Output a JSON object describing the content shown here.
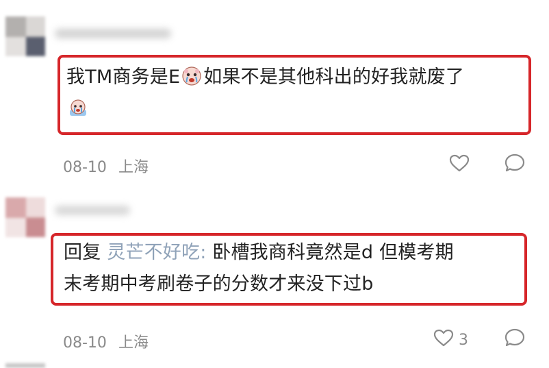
{
  "comments": [
    {
      "text_before_emoji": "我TM商务是E",
      "emoji_1": "crying-face-emoji",
      "text_after_emoji": "如果不是其他科出的好我就废了",
      "emoji_2": "crying-face-emoji",
      "date": "08-10",
      "location": "上海",
      "like_icon": "heart-outline-icon",
      "reply_icon": "speech-bubble-icon",
      "highlight_color": "#d6262a"
    },
    {
      "reply_prefix": "回复",
      "reply_target": "灵芒不好吃:",
      "line_1": " 卧槽我商科竟然是d 但模考期",
      "line_2": "末考期中考刷卷子的分数才来没下过b",
      "date": "08-10",
      "location": "上海",
      "like_icon": "heart-outline-icon",
      "like_count": "3",
      "reply_icon": "speech-bubble-icon",
      "highlight_color": "#d6262a"
    }
  ],
  "colors": {
    "text": "#222222",
    "meta": "#8a8a8a",
    "reply_target": "#8fa2b8",
    "highlight": "#d6262a"
  }
}
